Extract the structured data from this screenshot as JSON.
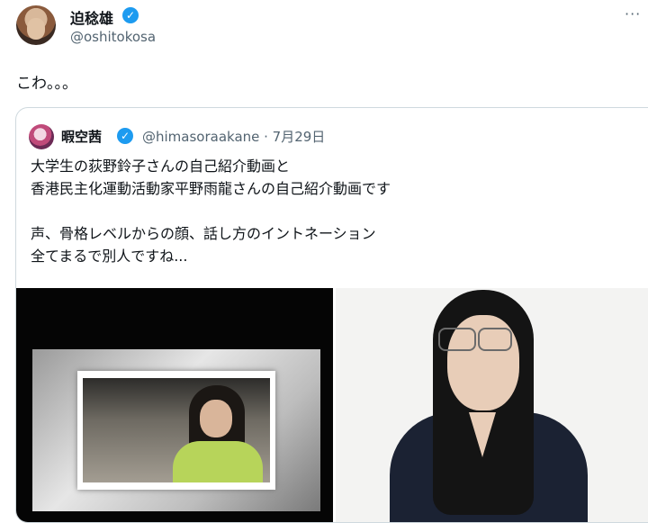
{
  "tweet": {
    "display_name": "迫稔雄",
    "handle": "@oshitokosa",
    "text": "こわ。。。",
    "more_icon": "···"
  },
  "quoted": {
    "display_name": "暇空茜",
    "handle_date": "@himasoraakane · 7月29日",
    "lines": [
      "大学生の荻野鈴子さんの自己紹介動画と",
      "香港民主化運動活動家平野雨龍さんの自己紹介動画です",
      "声、骨格レベルからの顔、話し方のイントネーション",
      "全てまるで別人ですね..."
    ]
  },
  "colors": {
    "accent": "#1d9bf0",
    "muted": "#536471",
    "border": "#cfd9de"
  },
  "icons": {
    "verified": "✓"
  }
}
